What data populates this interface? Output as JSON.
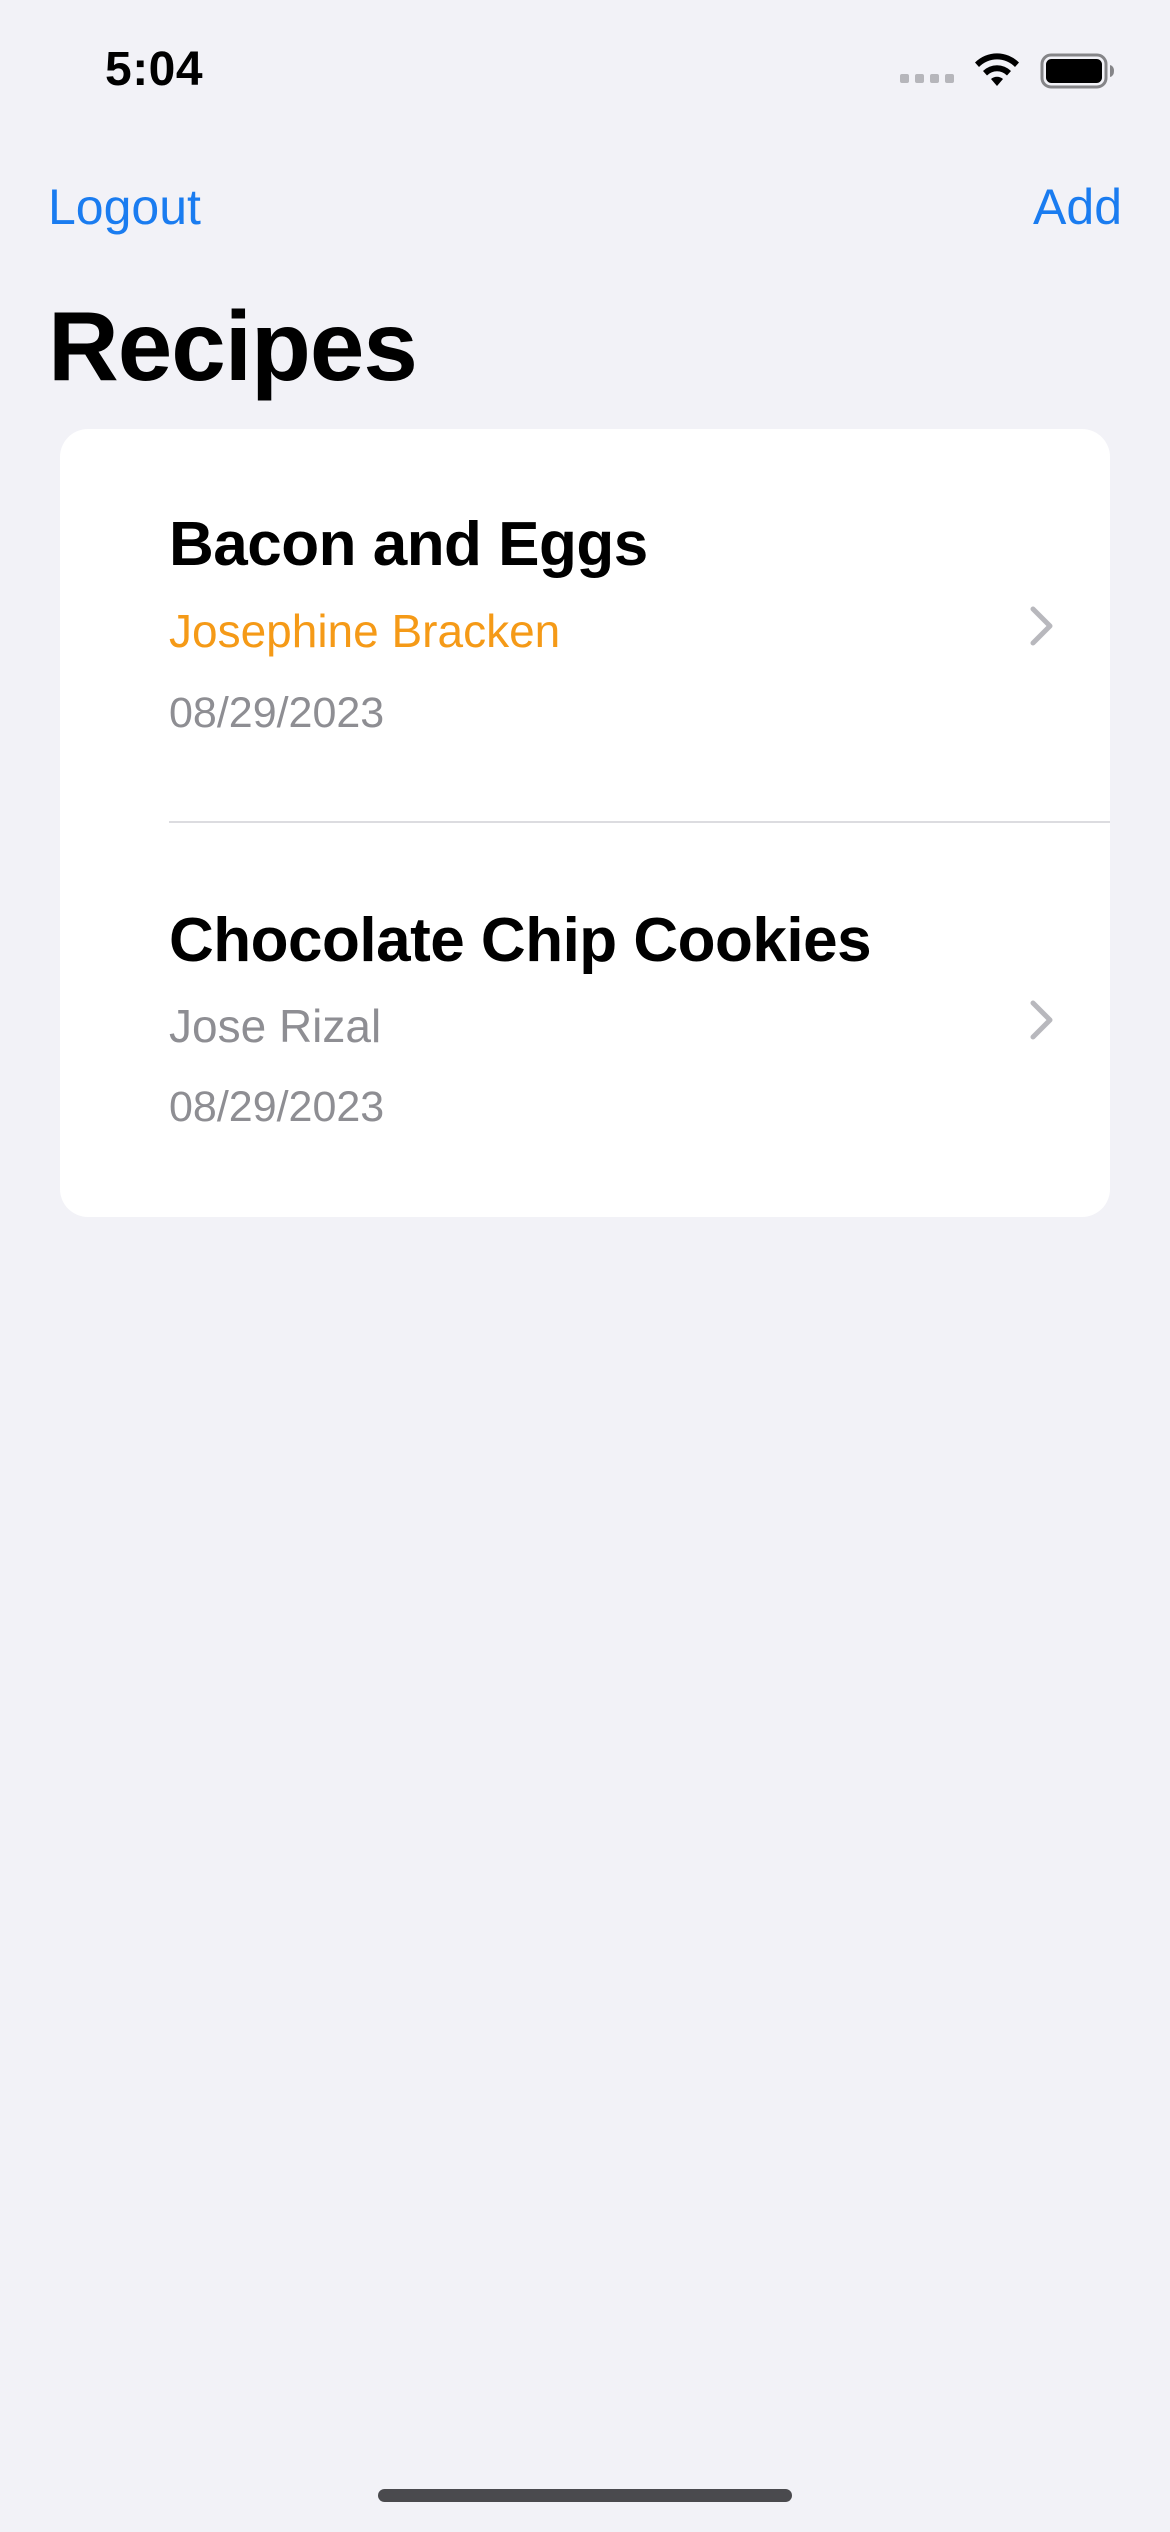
{
  "status_bar": {
    "time": "5:04"
  },
  "nav": {
    "left_button": "Logout",
    "right_button": "Add"
  },
  "page": {
    "title": "Recipes"
  },
  "recipes": [
    {
      "title": "Bacon and Eggs",
      "author": "Josephine Bracken",
      "author_color": "#f59a17",
      "date": "08/29/2023"
    },
    {
      "title": "Chocolate Chip Cookies",
      "author": "Jose Rizal",
      "author_color": "#8e8e93",
      "date": "08/29/2023"
    }
  ],
  "colors": {
    "accent": "#1a7cf0",
    "background": "#f2f2f7",
    "card": "#ffffff",
    "secondary_text": "#8e8e93"
  },
  "icons": [
    "cellular-signal-icon",
    "wifi-icon",
    "battery-icon",
    "chevron-right-icon"
  ]
}
